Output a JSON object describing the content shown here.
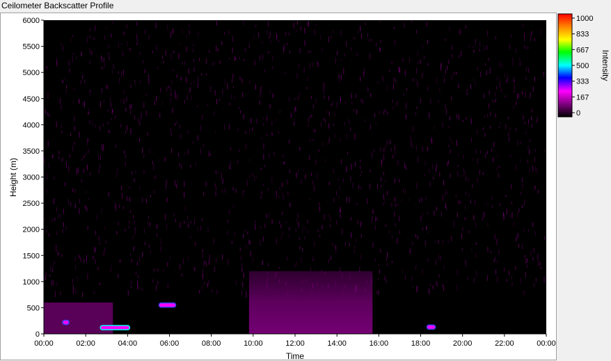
{
  "window": {
    "title": "Ceilometer Backscatter Profile"
  },
  "chart_data": {
    "type": "heatmap",
    "title": "Ceilometer Backscatter Profile",
    "xlabel": "Time",
    "ylabel": "Height (m)",
    "x_ticks": [
      "00:00",
      "02:00",
      "04:00",
      "06:00",
      "08:00",
      "10:00",
      "12:00",
      "14:00",
      "16:00",
      "18:00",
      "20:00",
      "22:00",
      "00:00"
    ],
    "x_range_hours": [
      0,
      24
    ],
    "y_ticks": [
      0,
      500,
      1000,
      1500,
      2000,
      2500,
      3000,
      3500,
      4000,
      4500,
      5000,
      5500,
      6000
    ],
    "ylim": [
      0,
      6000
    ],
    "colorbar": {
      "label": "Intensity",
      "ticks": [
        1000,
        833,
        667,
        500,
        333,
        167,
        0
      ],
      "range": [
        0,
        1000
      ],
      "colors": [
        "#000000",
        "#7a007a",
        "#ff00ff",
        "#0000ff",
        "#00ffff",
        "#00ff00",
        "#ffff00",
        "#ff8000",
        "#ff0000"
      ]
    },
    "features": [
      {
        "name": "residual-layer",
        "start_hour": 9.8,
        "end_hour": 15.7,
        "top_m": 1200,
        "intensity": 220
      },
      {
        "name": "morning-aerosol",
        "start_hour": 0.0,
        "end_hour": 3.3,
        "top_m": 600,
        "intensity": 250
      },
      {
        "name": "strong-return-1",
        "start_hour": 0.9,
        "end_hour": 1.2,
        "height_m": 220,
        "intensity": 420
      },
      {
        "name": "strong-return-2",
        "start_hour": 2.7,
        "end_hour": 4.1,
        "height_m": 120,
        "intensity": 480
      },
      {
        "name": "strong-return-3",
        "start_hour": 5.5,
        "end_hour": 6.3,
        "height_m": 550,
        "intensity": 420
      },
      {
        "name": "strong-return-4",
        "start_hour": 18.3,
        "end_hour": 18.7,
        "height_m": 130,
        "intensity": 430
      }
    ]
  }
}
